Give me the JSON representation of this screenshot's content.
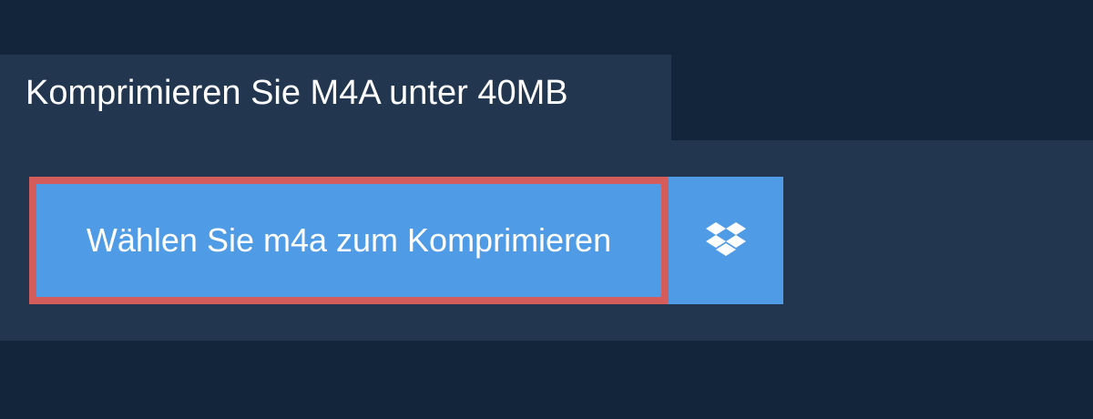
{
  "header": {
    "title": "Komprimieren Sie M4A unter 40MB"
  },
  "upload": {
    "label": "Wählen Sie m4a zum Komprimieren"
  },
  "dropbox": {
    "icon": "dropbox-icon"
  },
  "colors": {
    "page_background": "#12253a",
    "panel_background": "#22364f",
    "button_blue": "#4f9be6",
    "focus_outline_red": "#d45c5a",
    "text_white": "#ffffff"
  }
}
